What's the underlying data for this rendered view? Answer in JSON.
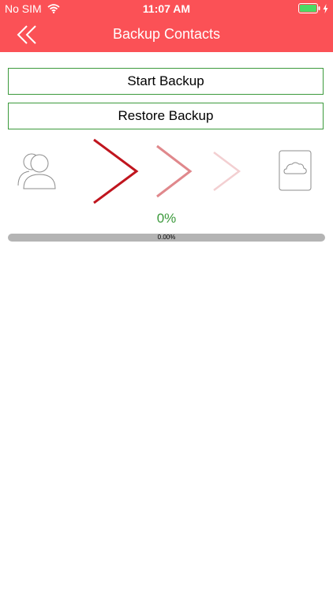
{
  "status_bar": {
    "carrier": "No SIM",
    "time": "11:07 AM",
    "wifi_icon": "wifi-icon",
    "battery_icon": "battery-icon",
    "charging_icon": "bolt-icon"
  },
  "nav": {
    "title": "Backup Contacts",
    "back_icon": "double-chevron-left-icon"
  },
  "actions": {
    "start_label": "Start Backup",
    "restore_label": "Restore Backup"
  },
  "transfer": {
    "source_icon": "contacts-icon",
    "arrow_icon": "chevron-right-icon",
    "destination_icon": "cloud-icon"
  },
  "progress": {
    "percent_label": "0%",
    "bar_text": "0.00%",
    "value": 0
  },
  "colors": {
    "header": "#fb5156",
    "accent_green": "#3c9a3c",
    "arrow_dark": "#c0151e",
    "arrow_mid": "#e0888c",
    "arrow_light": "#f3cfd1",
    "progress_track": "#b4b4b4"
  }
}
